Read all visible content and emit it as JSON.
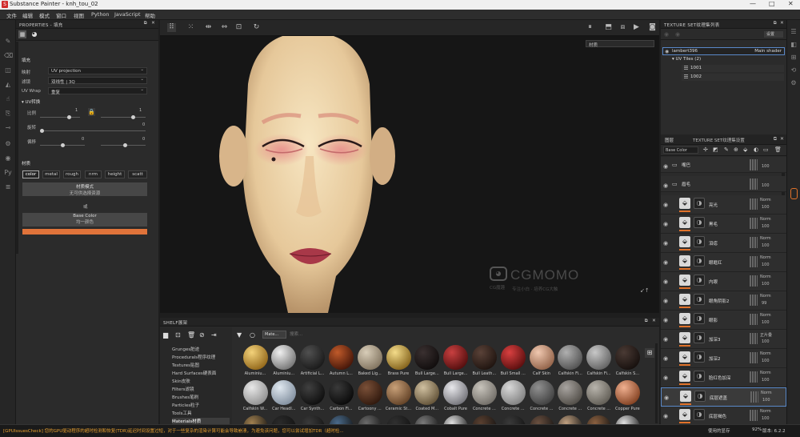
{
  "window": {
    "title": "Substance Painter - knh_tou_02",
    "controls": [
      "—",
      "□",
      "✕"
    ]
  },
  "menu": [
    "文件",
    "编辑",
    "模式",
    "窗口",
    "视图",
    "Python",
    "JavaScript",
    "帮助"
  ],
  "left_icons": [
    "paint-brush-icon",
    "eraser-icon",
    "projection-icon",
    "polyfill-icon",
    "smudge-icon",
    "clone-icon",
    "picker-icon",
    "settings-icon",
    "viewer-icon",
    "python-icon",
    "log-icon"
  ],
  "properties": {
    "header": "PROPERTIES - 填充",
    "section_fill": "填充",
    "mapping_label": "映射",
    "mapping_value": "UV projection",
    "filter_label": "滤镜",
    "filter_value": "双线性 | 3Q",
    "uvwrap_label": "UV Wrap",
    "uvwrap_value": "重复",
    "uv_transform": "UV转换",
    "scale_label": "比例",
    "scale_value": "1",
    "rotation_label": "旋转",
    "rotation_value": "0",
    "offset_label": "偏移",
    "offset_x": "0",
    "offset_y": "0",
    "material_section": "材质",
    "channels": [
      "color",
      "metal",
      "rough",
      "nrm",
      "height",
      "scatt"
    ],
    "material_mode_title": "材质模式",
    "material_mode_sub": "无可供选择资源",
    "or_label": "或",
    "base_color_title": "Base Color",
    "base_color_sub": "均一颜色",
    "base_color_hex": "#e0733a"
  },
  "viewport": {
    "texture_select": "材质",
    "watermark_brand": "CGMOMO",
    "watermark_small": "CG魔趣",
    "watermark_tag": "专注小白 · 培养CG大触",
    "play_icon": "pause-icon"
  },
  "texture_set_list": {
    "header": "TEXTURE SET纹理集列表",
    "settings_btn": "设置",
    "item_name": "lambert396",
    "item_shader": "Main shader",
    "uv_tiles": "UV Tiles (2)",
    "tiles": [
      "1001",
      "1002"
    ]
  },
  "layers_panel": {
    "tab_layers": "图层",
    "tab_texset_settings": "TEXTURE SET纹理集设置",
    "channel_select": "Base Color",
    "layers": [
      {
        "name": "嘴巴",
        "type": "folder",
        "blend": "",
        "opacity": "100"
      },
      {
        "name": "眉毛",
        "type": "folder",
        "blend": "",
        "opacity": "100"
      },
      {
        "name": "亮光",
        "type": "fill",
        "blend": "Norm",
        "opacity": "100"
      },
      {
        "name": "黑毛",
        "type": "fill",
        "blend": "Norm",
        "opacity": "100"
      },
      {
        "name": "泪痣",
        "type": "fill",
        "blend": "Norm",
        "opacity": "100"
      },
      {
        "name": "眼眶红",
        "type": "fill",
        "blend": "Norm",
        "opacity": "100"
      },
      {
        "name": "内眼",
        "type": "fill",
        "blend": "Norm",
        "opacity": "100"
      },
      {
        "name": "眼角阴影2",
        "type": "fill",
        "blend": "Norm",
        "opacity": "99"
      },
      {
        "name": "眼影",
        "type": "fill",
        "blend": "Norm",
        "opacity": "100"
      },
      {
        "name": "加深3",
        "type": "fill",
        "blend": "正片叠",
        "opacity": "100"
      },
      {
        "name": "加深2",
        "type": "fill",
        "blend": "Norm",
        "opacity": "100"
      },
      {
        "name": "脸红色加深",
        "type": "fill",
        "blend": "Norm",
        "opacity": "100"
      },
      {
        "name": "底层遮盖",
        "type": "fill",
        "blend": "Norm",
        "opacity": "100"
      },
      {
        "name": "底层褐色",
        "type": "fill",
        "blend": "Norm",
        "opacity": "100"
      }
    ]
  },
  "shelf": {
    "header": "SHELF展架",
    "search_text": "Mate...",
    "search_placeholder": "搜索...",
    "categories": [
      "Grunges脏迹",
      "Procedurals程序纹理",
      "Textures贴图",
      "Hard Surfaces硬表面",
      "Skin皮肤",
      "Filters滤镜",
      "Brushes笔刷",
      "Particles粒子",
      "Tools工具",
      "Materials材质"
    ],
    "materials_row1": [
      {
        "label": "Aluminiu...",
        "c1": "#f3d27a",
        "c2": "#8a5e12"
      },
      {
        "label": "Aluminiu...",
        "c1": "#f0f0f0",
        "c2": "#6a6a6a"
      },
      {
        "label": "Artificial L...",
        "c1": "#505050",
        "c2": "#151515"
      },
      {
        "label": "Autumn L...",
        "c1": "#c05a2a",
        "c2": "#3a1006"
      },
      {
        "label": "Baked Lig...",
        "c1": "#d8cdb8",
        "c2": "#7a6c58"
      },
      {
        "label": "Brass Pure",
        "c1": "#f4dc8a",
        "c2": "#7a5812"
      },
      {
        "label": "Bull Large...",
        "c1": "#3a3030",
        "c2": "#0d0a0a"
      },
      {
        "label": "Bull Large...",
        "c1": "#c84040",
        "c2": "#4a0a0a"
      },
      {
        "label": "Bull Leath...",
        "c1": "#5a4238",
        "c2": "#1a100c"
      },
      {
        "label": "Bull Small ...",
        "c1": "#d84040",
        "c2": "#500a0a"
      },
      {
        "label": "Calf Skin",
        "c1": "#f0c8b0",
        "c2": "#8a5a40"
      },
      {
        "label": "Calfskin Fi...",
        "c1": "#b0b0b0",
        "c2": "#4a4a4a"
      },
      {
        "label": "Calfskin Fi...",
        "c1": "#c8c8c8",
        "c2": "#5a5a5a"
      },
      {
        "label": "Calfskin S...",
        "c1": "#4a3a34",
        "c2": "#120c0a"
      }
    ],
    "materials_row2": [
      {
        "label": "Calfskin W...",
        "c1": "#e8e8e8",
        "c2": "#8a8a8a"
      },
      {
        "label": "Car Headl...",
        "c1": "#e0e8f0",
        "c2": "#7a8898"
      },
      {
        "label": "Car Synth...",
        "c1": "#404040",
        "c2": "#0a0a0a"
      },
      {
        "label": "Carbon Fi...",
        "c1": "#3a3a3a",
        "c2": "#050505"
      },
      {
        "label": "Cartoony ...",
        "c1": "#7a5038",
        "c2": "#2a140a"
      },
      {
        "label": "Ceramic St...",
        "c1": "#c8a078",
        "c2": "#5a3a20"
      },
      {
        "label": "Coated M...",
        "c1": "#d0c0a0",
        "c2": "#5a4a30"
      },
      {
        "label": "Cobalt Pure",
        "c1": "#e8e8ec",
        "c2": "#6a6a70"
      },
      {
        "label": "Concrete ...",
        "c1": "#c8c4bc",
        "c2": "#6a6660"
      },
      {
        "label": "Concrete ...",
        "c1": "#d8d8d8",
        "c2": "#7a7a7a"
      },
      {
        "label": "Concrete ...",
        "c1": "#909090",
        "c2": "#3a3a3a"
      },
      {
        "label": "Concrete ...",
        "c1": "#a8a4a0",
        "c2": "#4a4640"
      },
      {
        "label": "Concrete ...",
        "c1": "#b8b4ac",
        "c2": "#5a564e"
      },
      {
        "label": "Copper Pure",
        "c1": "#f0b090",
        "c2": "#7a3818"
      }
    ]
  },
  "status": {
    "message": "[GPUIssuesCheck] 您的GPU驱动程序的超时检测和恢复(TDR)延迟时间设置过短，对于一些复杂的渲染计算可能会导致崩溃，为避免该问题，您可以尝试增加TDR（超时检...",
    "memory_label": "使用的显存",
    "memory_value": "92%",
    "version_label": "版本: 6.2.2"
  }
}
